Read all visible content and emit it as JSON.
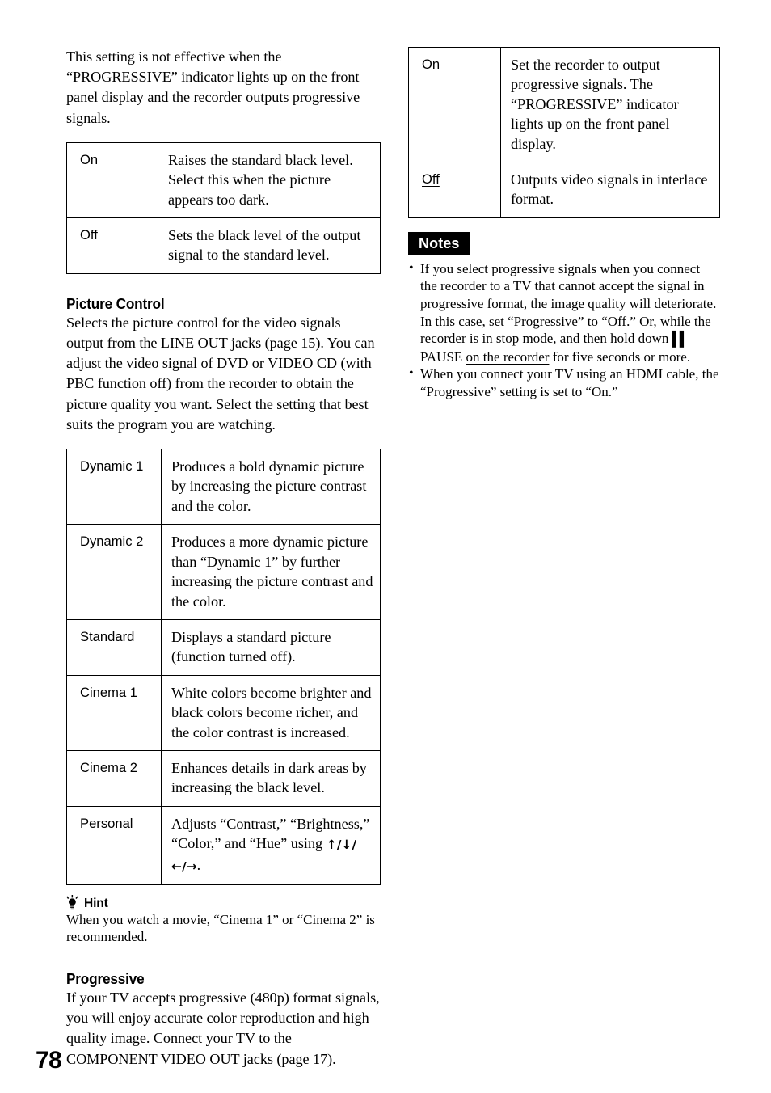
{
  "page": {
    "number": "78"
  },
  "left_column": {
    "intro_paragraph": "This setting is not effective when the “PROGRESSIVE” indicator lights up on the front panel display and the recorder outputs progressive signals.",
    "black_level_table": {
      "rows": [
        {
          "key": "On",
          "key_underlined": true,
          "description": "Raises the standard black level. Select this when the picture appears too dark."
        },
        {
          "key": "Off",
          "key_underlined": false,
          "description": "Sets the black level of the output signal to the standard level."
        }
      ]
    },
    "picture_control": {
      "heading": "Picture Control",
      "body": "Selects the picture control for the video signals output from the LINE OUT jacks (page 15). You can adjust the video signal of DVD or VIDEO CD (with PBC function off) from the recorder to obtain the picture quality you want. Select the setting that best suits the program you are watching.",
      "table": {
        "rows": [
          {
            "key": "Dynamic 1",
            "key_underlined": false,
            "description": "Produces a bold dynamic picture by increasing the picture contrast and the color."
          },
          {
            "key": "Dynamic 2",
            "key_underlined": false,
            "description": "Produces a more dynamic picture than “Dynamic 1” by further increasing the picture contrast and the color."
          },
          {
            "key": "Standard",
            "key_underlined": true,
            "description": "Displays a standard picture (function turned off)."
          },
          {
            "key": "Cinema 1",
            "key_underlined": false,
            "description": "White colors become brighter and black colors become richer, and the color contrast is increased."
          },
          {
            "key": "Cinema 2",
            "key_underlined": false,
            "description": "Enhances details in dark areas by increasing the black level."
          },
          {
            "key": "Personal",
            "key_underlined": false,
            "description_prefix": "Adjusts “Contrast,” “Brightness,” “Color,” and “Hue” using ",
            "arrows_vertical": "↑/↓/",
            "arrows_horizontal": "←/→",
            "description_suffix": "."
          }
        ]
      }
    },
    "hint": {
      "icon": "lightbulb-icon",
      "label": "Hint",
      "body": "When you watch a movie, “Cinema 1” or “Cinema 2” is recommended."
    },
    "progressive": {
      "heading": "Progressive",
      "body": "If your TV accepts progressive (480p) format signals, you will enjoy accurate color reproduction and high quality image. Connect your TV to the COMPONENT VIDEO OUT jacks (page 17)."
    }
  },
  "right_column": {
    "progressive_table": {
      "rows": [
        {
          "key": "On",
          "key_underlined": false,
          "description": "Set the recorder to output progressive signals. The “PROGRESSIVE” indicator lights up on the front panel display."
        },
        {
          "key": "Off",
          "key_underlined": true,
          "description": "Outputs video signals in interlace format."
        }
      ]
    },
    "notes": {
      "badge_label": "Notes",
      "items": [
        {
          "bullet": "•",
          "text_part_1": "If you select progressive signals when you connect the recorder to a TV that cannot accept the signal in progressive format, the image quality will deteriorate. In this case, set “Progressive” to “Off.” Or, while the recorder is in stop mode, and then hold down ",
          "pause_icon": "▌▌",
          "text_part_2": " PAUSE ",
          "underlined_text": "on the recorder",
          "text_part_3": " for five seconds or more."
        },
        {
          "bullet": "•",
          "text_part_1": "When you connect your TV using an HDMI cable, the “Progressive” setting is set to “On.”"
        }
      ]
    }
  }
}
